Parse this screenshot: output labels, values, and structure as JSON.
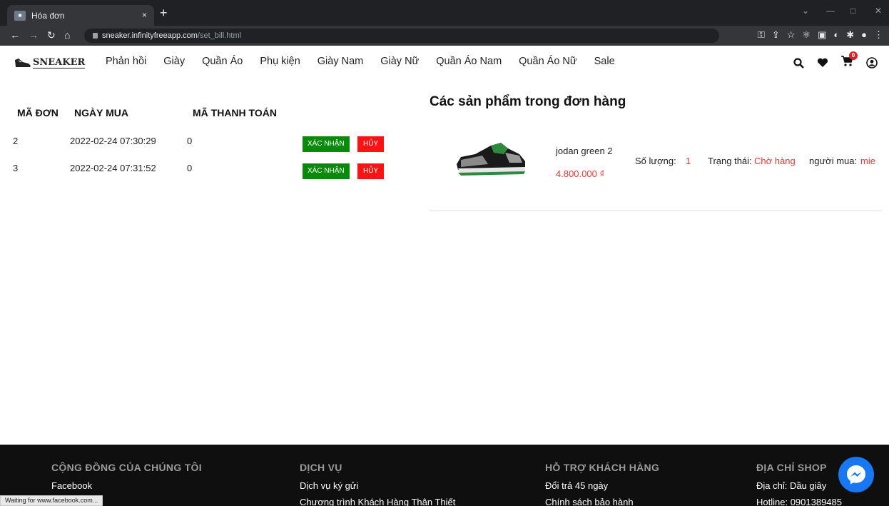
{
  "browser": {
    "tab_title": "Hóa đơn",
    "tab_close": "×",
    "new_tab": "+",
    "url_host": "sneaker.infinityfreeapp.com",
    "url_path": "/set_bill.html",
    "status_text": "Waiting for www.facebook.com..."
  },
  "header": {
    "logo_text": "SNEAKER",
    "nav": [
      "Phản hồi",
      "Giày",
      "Quần Áo",
      "Phụ kiện",
      "Giày Nam",
      "Giày Nữ",
      "Quần Áo Nam",
      "Quần Áo Nữ",
      "Sale"
    ],
    "cart_count": "0"
  },
  "orders": {
    "headers": {
      "id": "MÃ ĐƠN",
      "date": "NGÀY MUA",
      "payment": "MÃ THANH TOÁN"
    },
    "confirm_label": "XÁC NHẬN",
    "cancel_label": "HỦY",
    "rows": [
      {
        "id": "2",
        "date": "2022-02-24 07:30:29",
        "payment": "0"
      },
      {
        "id": "3",
        "date": "2022-02-24 07:31:52",
        "payment": "0"
      }
    ]
  },
  "products": {
    "title": "Các sản phẩm trong đơn hàng",
    "items": [
      {
        "name": "jodan green 2",
        "price": "4.800.000 ₫",
        "qty_label": "Số lượng:",
        "qty": "1",
        "status_label": "Trạng thái:",
        "status": "Chờ hàng",
        "buyer_label": "người mua:",
        "buyer": "mie"
      }
    ]
  },
  "footer": {
    "columns": [
      {
        "title": "CỘNG ĐỒNG CỦA CHÚNG TÔI",
        "items": [
          "Facebook"
        ]
      },
      {
        "title": "DỊCH VỤ",
        "items": [
          "Dịch vụ ký gửi",
          "Chương trình Khách Hàng Thân Thiết"
        ]
      },
      {
        "title": "HỖ TRỢ KHÁCH HÀNG",
        "items": [
          "Đổi trả 45 ngày",
          "Chính sách bảo hành"
        ]
      },
      {
        "title": "ĐỊA CHỈ SHOP",
        "items": [
          "Địa chỉ: Dầu giây",
          "Hotline: 0901389485"
        ]
      }
    ]
  },
  "colors": {
    "confirm": "#0a8a0a",
    "cancel": "#ff1212",
    "accent_red": "#e53935",
    "footer_bg": "#0f0f0f",
    "messenger": "#1877f2"
  }
}
